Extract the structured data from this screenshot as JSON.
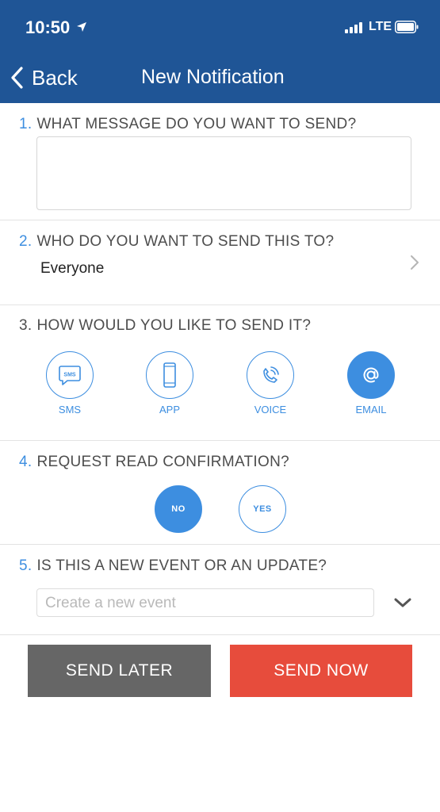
{
  "status_bar": {
    "time": "10:50",
    "network": "LTE"
  },
  "nav": {
    "back_label": "Back",
    "title": "New Notification"
  },
  "sections": {
    "message": {
      "number": "1.",
      "title": "WHAT MESSAGE DO YOU WANT TO SEND?",
      "value": ""
    },
    "recipients": {
      "number": "2.",
      "title": "WHO DO YOU WANT TO SEND THIS TO?",
      "value": "Everyone"
    },
    "method": {
      "number": "3.",
      "title": "HOW WOULD YOU LIKE TO SEND IT?",
      "options": [
        {
          "label": "SMS",
          "icon": "sms-bubble-icon",
          "selected": false
        },
        {
          "label": "APP",
          "icon": "phone-icon",
          "selected": false
        },
        {
          "label": "VOICE",
          "icon": "phone-call-icon",
          "selected": false
        },
        {
          "label": "EMAIL",
          "icon": "at-sign-icon",
          "selected": true
        }
      ]
    },
    "confirmation": {
      "number": "4.",
      "title": "REQUEST READ CONFIRMATION?",
      "options": [
        {
          "label": "NO",
          "selected": true
        },
        {
          "label": "YES",
          "selected": false
        }
      ]
    },
    "event": {
      "number": "5.",
      "title": "IS THIS A NEW EVENT OR AN UPDATE?",
      "placeholder": "Create a new event"
    }
  },
  "actions": {
    "send_later": "SEND LATER",
    "send_now": "SEND NOW"
  },
  "colors": {
    "header": "#1f5596",
    "accent": "#3d8ee0",
    "send_later": "#666666",
    "send_now": "#e74c3c"
  }
}
